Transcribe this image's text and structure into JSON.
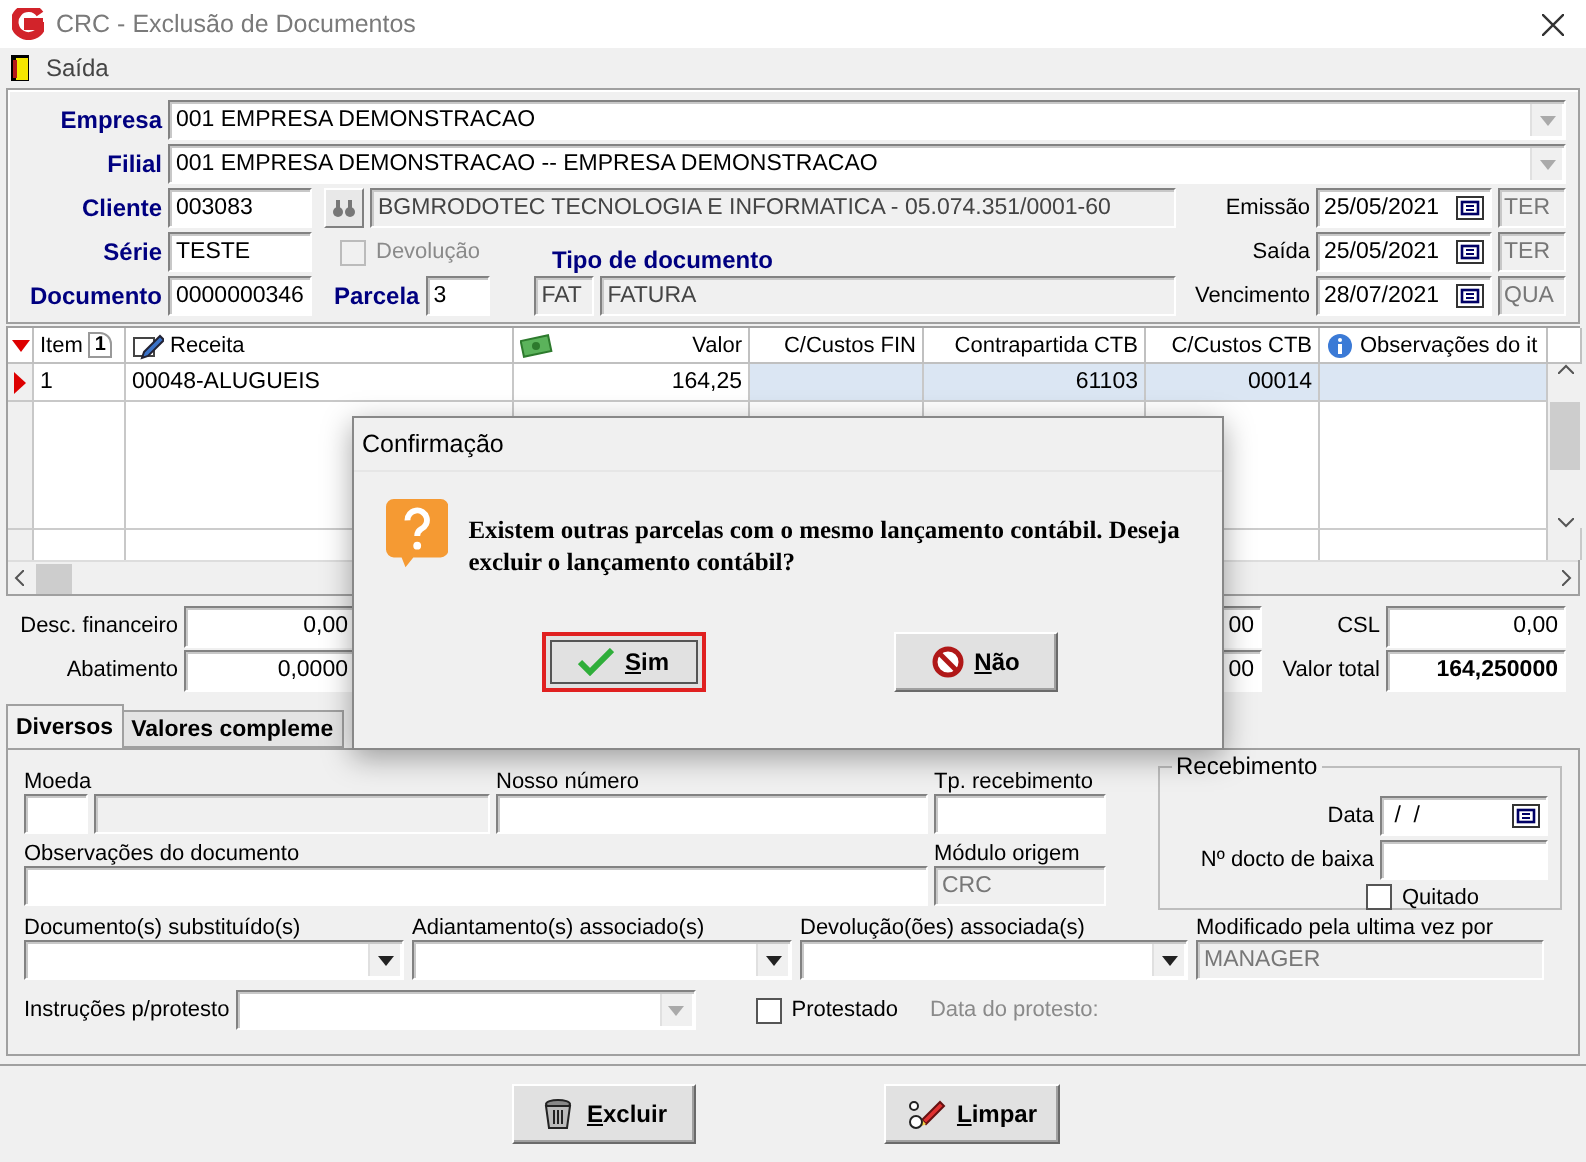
{
  "window": {
    "title": "CRC - Exclusão de Documentos"
  },
  "menu": [
    {
      "label": "Saída"
    }
  ],
  "header": {
    "empresa": {
      "label": "Empresa",
      "value": "001 EMPRESA DEMONSTRACAO"
    },
    "filial": {
      "label": "Filial",
      "value": "001 EMPRESA DEMONSTRACAO -- EMPRESA DEMONSTRACAO"
    },
    "cliente": {
      "label": "Cliente",
      "code": "003083",
      "name": "BGMRODOTEC TECNOLOGIA  E INFORMATICA - 05.074.351/0001-60"
    },
    "serie": {
      "label": "Série",
      "value": "TESTE"
    },
    "devolucao": {
      "label": "Devolução",
      "checked": false,
      "disabled": true
    },
    "tipo_documento": {
      "label": "Tipo de documento",
      "code": "FAT",
      "name": "FATURA"
    },
    "documento": {
      "label": "Documento",
      "value": "0000000346"
    },
    "parcela": {
      "label": "Parcela",
      "value": "3"
    },
    "dates": [
      {
        "label": "Emissão",
        "value": "25/05/2021",
        "day": "TER"
      },
      {
        "label": "Saída",
        "value": "25/05/2021",
        "day": "TER"
      },
      {
        "label": "Vencimento",
        "value": "28/07/2021",
        "day": "QUA"
      }
    ]
  },
  "table": {
    "columns": [
      {
        "label": "Item",
        "sort": "1"
      },
      {
        "label": "Receita"
      },
      {
        "label": "Valor"
      },
      {
        "label": "C/Custos FIN"
      },
      {
        "label": "Contrapartida CTB"
      },
      {
        "label": "C/Custos CTB"
      },
      {
        "label": "Observações do it"
      }
    ],
    "rows": [
      {
        "selected": true,
        "cells": [
          "1",
          "00048-ALUGUEIS",
          "164,25",
          null,
          "61103",
          "00014",
          null
        ]
      }
    ]
  },
  "totals": {
    "left": [
      {
        "label": "Desc. financeiro",
        "value": "0,00"
      },
      {
        "label": "Abatimento",
        "value": "0,0000"
      }
    ],
    "middle": [
      {
        "value": "00"
      },
      {
        "value": "00"
      }
    ],
    "right": [
      {
        "label": "CSL",
        "value": "0,00"
      },
      {
        "label": "Valor total",
        "value": "164,250000"
      }
    ]
  },
  "tabs": [
    {
      "label": "Diversos",
      "selected": true
    },
    {
      "label": "Valores compleme",
      "selected": false
    }
  ],
  "diversos": {
    "moeda": {
      "label": "Moeda"
    },
    "nosso_numero": {
      "label": "Nosso número"
    },
    "tp_recebimento": {
      "label": "Tp. recebimento"
    },
    "observacoes": {
      "label": "Observações do documento"
    },
    "modulo_origem": {
      "label": "Módulo origem",
      "value": "CRC"
    },
    "recebimento": {
      "title": "Recebimento",
      "data_label": "Data",
      "data_value": " /  /",
      "docto_label": "Nº docto de baixa",
      "quitado": {
        "label": "Quitado",
        "checked": false
      }
    },
    "combos": [
      {
        "label": "Documento(s) substituído(s)"
      },
      {
        "label": "Adiantamento(s) associado(s)"
      },
      {
        "label": "Devolução(ões) associada(s)"
      }
    ],
    "modificado": {
      "label": "Modificado pela ultima vez por",
      "value": "MANAGER"
    },
    "instrucoes": {
      "label": "Instruções p/protesto",
      "disabled": true
    },
    "protestado": {
      "label": "Protestado",
      "checked": false
    },
    "data_protesto": {
      "label": "Data do protesto:",
      "disabled": true
    }
  },
  "buttons": [
    {
      "label": "Excluir"
    },
    {
      "label": "Limpar"
    }
  ],
  "dialog": {
    "title": "Confirmação",
    "message": "Existem outras parcelas com o mesmo lançamento contábil. Deseja excluir o lançamento contábil?",
    "buttons": [
      {
        "label": "Sim",
        "kind": "yes",
        "focused": true
      },
      {
        "label": "Não",
        "kind": "no",
        "focused": false
      }
    ]
  }
}
